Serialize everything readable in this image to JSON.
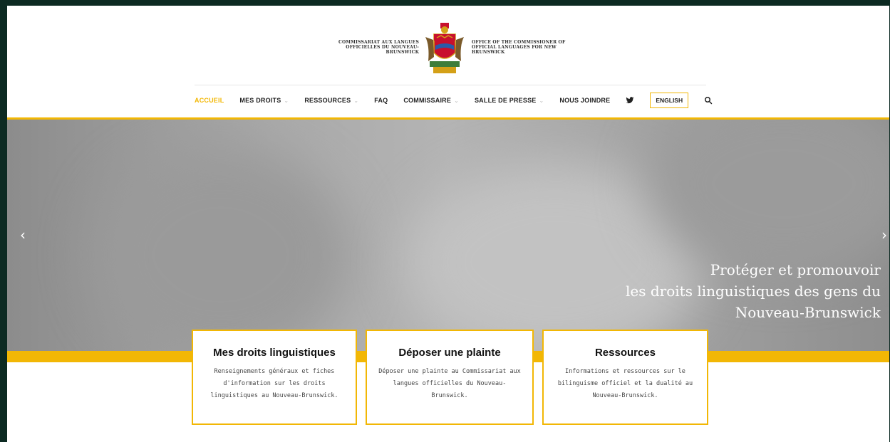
{
  "header": {
    "logo_fr": "COMMISSARIAT AUX LANGUES OFFICIELLES DU NOUVEAU-BRUNSWICK",
    "logo_en": "OFFICE OF THE COMMISSIONER OF OFFICIAL LANGUAGES FOR NEW BRUNSWICK"
  },
  "nav": {
    "items": [
      {
        "label": "ACCUEIL",
        "active": true
      },
      {
        "label": "MES DROITS",
        "dropdown": true
      },
      {
        "label": "RESSOURCES",
        "dropdown": true
      },
      {
        "label": "FAQ",
        "dropdown": false
      },
      {
        "label": "COMMISSAIRE",
        "dropdown": true
      },
      {
        "label": "SALLE DE PRESSE",
        "dropdown": true
      },
      {
        "label": "NOUS JOINDRE",
        "dropdown": false
      }
    ],
    "english_label": "ENGLISH",
    "icons": [
      "twitter-icon",
      "search-icon"
    ]
  },
  "hero": {
    "line1": "Protéger et promouvoir",
    "line2": "les droits linguistiques des gens du",
    "line3": "Nouveau-Brunswick",
    "prev_icon": "chevron-left-icon",
    "next_icon": "chevron-right-icon"
  },
  "cards": [
    {
      "title": "Mes droits linguistiques",
      "text": "Renseignements généraux et fiches d'information sur les droits linguistiques au Nouveau-Brunswick."
    },
    {
      "title": "Déposer une plainte",
      "text": "Déposer une plainte au Commissariat aux langues officielles du Nouveau-Brunswick."
    },
    {
      "title": "Ressources",
      "text": "Informations et ressources sur le bilinguisme officiel et la dualité au Nouveau-Brunswick."
    }
  ],
  "colors": {
    "accent": "#f2b705",
    "frame": "#0c2a22",
    "text": "#222222"
  }
}
